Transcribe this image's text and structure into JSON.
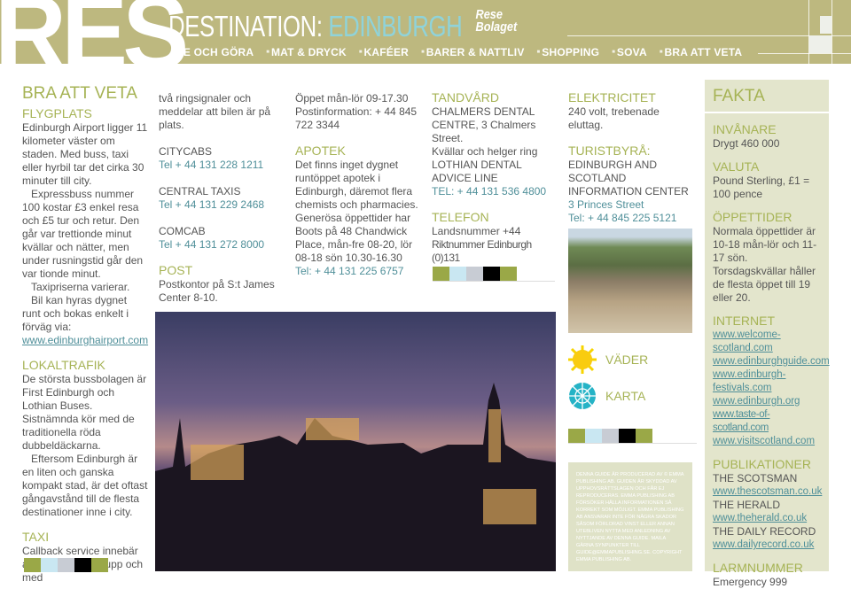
{
  "header": {
    "logo": "RES",
    "title_prefix": "DESTINATION: ",
    "title_city": "EDINBURGH",
    "brand": "Rese Bolaget",
    "nav": [
      "SE OCH GÖRA",
      "MAT & DRYCK",
      "KAFÉER",
      "BARER & NATTLIV",
      "SHOPPING",
      "SOVA",
      "BRA ATT VETA"
    ]
  },
  "col1": {
    "title": "BRA ATT VETA",
    "flyg_h": "FLYGPLATS",
    "flyg_p1": "Edinburgh Airport ligger 11 kilometer väster om staden. Med buss, taxi eller hyrbil tar det cirka 30 minuter till city.",
    "flyg_p2": "Expressbuss nummer 100 kostar £3 enkel resa och £5 tur och retur. Den går var trettionde minut kvällar och nätter, men under rusningstid går den var tionde minut.",
    "flyg_p3": "Taxipriserna varierar.",
    "flyg_p4": "Bil kan hyras dygnet runt och bokas enkelt i förväg via:",
    "flyg_url": "www.edinburghairport.com",
    "lokal_h": "LOKALTRAFIK",
    "lokal_p1": "De största bussbolagen är First Edinburgh och Lothian Buses. Sistnämnda kör med de traditionella röda dubbeldäckarna.",
    "lokal_p2": "Eftersom Edinburgh är en liten och ganska kompakt stad, är det oftast gångavstånd till de flesta destinationer inne i city.",
    "taxi_h": "TAXI",
    "taxi_p": "Callback service innebär att bolaget ringer upp och med"
  },
  "col2": {
    "p": "två ringsignaler och meddelar att bilen är på plats.",
    "cabs": [
      {
        "name": "CITYCABS",
        "tel": "Tel + 44 131 228 1211"
      },
      {
        "name": "CENTRAL TAXIS",
        "tel": "Tel + 44 131 229 2468"
      },
      {
        "name": "COMCAB",
        "tel": "Tel + 44 131 272 8000"
      }
    ],
    "post_h": "POST",
    "post_p": "Postkontor på S:t James Center 8-10."
  },
  "col3": {
    "p1": "Öppet mån-lör 09-17.30",
    "p2": "Postinformation: + 44 845 722 3344",
    "apotek_h": "APOTEK",
    "apotek_p": "Det finns inget dygnet runtöppet apotek i Edinburgh, däremot flera chemists och pharmacies. Generösa öppettider har Boots på 48 Chandwick Place, mån-fre 08-20, lör 08-18 sön 10.30-16.30",
    "apotek_tel": "Tel: + 44 131 225 6757"
  },
  "col4": {
    "tand_h": "TANDVÅRD",
    "tand_p1": "CHALMERS DENTAL CENTRE, 3 Chalmers Street.",
    "tand_p2": "Kvällar och helger ring LOTHIAN DENTAL ADVICE LINE",
    "tand_tel": "TEL: + 44 131 536 4800",
    "tel_h": "TELEFON",
    "tel_p1": "Landsnummer +44",
    "tel_p2": "Riktnummer Edinburgh (0)131"
  },
  "col5": {
    "el_h": "ELEKTRICITET",
    "el_p": "240 volt, trebenade eluttag.",
    "tur_h": "TURISTBYRÅ:",
    "tur_p": "EDINBURGH AND SCOTLAND INFORMATION CENTER",
    "tur_addr": "3 Princes Street",
    "tur_tel": "Tel: + 44 845 225 5121",
    "weather": "VÄDER",
    "map": "KARTA",
    "disclaimer": "DENNA GUIDE ÄR PRODUCERAD AV © EMMA PUBLISHING AB. GUIDEN ÄR SKYDDAD AV UPPHOVSRÄTTSLAGEN OCH FÅR EJ REPRODUCERAS. EMMA PUBLISHING AB FÖRSÖKER HÅLLA INFORMATIONEN SÅ KORREKT SOM MÖJLIGT. EMMA PUBLISHING AB ANSVARAR INTE FÖR NÅGRA SKADOR SÅSOM FÖRLORAD VINST ELLER ANNAN UTEBLIVEN NYTTA MED ANLEDNING AV NYTTJANDE AV DENNA GUIDE. MAILA GÄRNA SYNPUNKTER TILL GUIDE@EMMAPUBLISHING.SE. COPYRIGHT EMMA PUBLISHING AB."
  },
  "fakta": {
    "title": "FAKTA",
    "inv_h": "INVÅNARE",
    "inv_p": "Drygt 460 000",
    "val_h": "VALUTA",
    "val_p": "Pound Sterling, £1 = 100 pence",
    "opp_h": "ÖPPETTIDER",
    "opp_p": "Normala öppettider är 10-18 mån-lör och 11-17 sön. Torsdagskvällar håller de flesta öppet till 19 eller 20.",
    "int_h": "INTERNET",
    "links": [
      "www.welcome-scotland.com",
      "www.edinburghguide.com",
      "www.edinburgh-festivals.com",
      "www.edinburgh.org",
      "www.taste-of-scotland.com",
      "www.visitscotland.com"
    ],
    "pub_h": "PUBLIKATIONER",
    "pubs": [
      {
        "name": "THE SCOTSMAN",
        "url": "www.thescotsman.co.uk"
      },
      {
        "name": "THE HERALD",
        "url": "www.theherald.co.uk"
      },
      {
        "name": "THE DAILY RECORD",
        "url": "www.dailyrecord.co.uk"
      }
    ],
    "larm_h": "LARMNUMMER",
    "larm_p": "Emergency 999"
  },
  "colors": {
    "header": "#bdb87f",
    "heading": "#a6b355",
    "link": "#4f8f99",
    "fakta_bg": "#e3e5cc",
    "swatches": [
      "#9aa847",
      "#c9e7f2",
      "#c8ccd4",
      "#000000",
      "#9aa847"
    ]
  }
}
